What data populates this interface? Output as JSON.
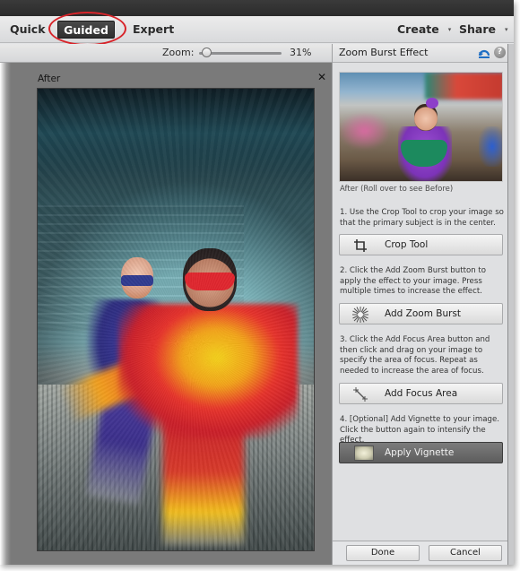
{
  "menubar": {
    "modes": [
      {
        "label": "Quick",
        "active": false
      },
      {
        "label": "Guided",
        "active": true
      },
      {
        "label": "Expert",
        "active": false
      }
    ],
    "right_menus": [
      {
        "label": "Create",
        "caret": "▾"
      },
      {
        "label": "Share",
        "caret": "▾"
      }
    ],
    "highlight_color": "#d8242a"
  },
  "zoombar": {
    "label": "Zoom:",
    "value_text": "31%",
    "value_percent": 31
  },
  "canvas": {
    "doc_label": "After",
    "close_glyph": "✕"
  },
  "panel": {
    "title": "Zoom Burst Effect",
    "reset_icon": "reset-icon",
    "help_glyph": "?",
    "preview_caption": "After (Roll over to see Before)",
    "steps": [
      {
        "text": "1. Use the Crop Tool to crop your image so that the primary subject is in the center.",
        "button": "Crop Tool",
        "icon": "crop-icon"
      },
      {
        "text": "2. Click the Add Zoom Burst button to apply the effect to your image. Press multiple times to increase the effect.",
        "button": "Add Zoom Burst",
        "icon": "zoom-burst-icon"
      },
      {
        "text": "3. Click the Add Focus Area button and then click and drag on your image to specify the area of focus. Repeat as needed to increase the area of focus.",
        "button": "Add Focus Area",
        "icon": "focus-area-icon"
      },
      {
        "text": "4. [Optional] Add Vignette to your image. Click the button again to intensify the effect.",
        "button": "Apply Vignette",
        "icon": "vignette-icon",
        "active": true
      }
    ],
    "footer": {
      "done": "Done",
      "cancel": "Cancel"
    }
  }
}
